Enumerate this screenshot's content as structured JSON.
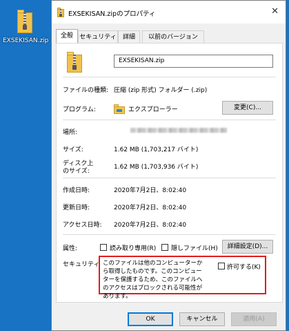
{
  "desktop": {
    "icon_label": "EXSEKISAN.zip"
  },
  "window": {
    "title": "EXSEKISAN.zipのプロパティ",
    "close_glyph": "✕"
  },
  "tabs": [
    {
      "label": "全般",
      "active": true
    },
    {
      "label": "セキュリティ"
    },
    {
      "label": "詳細"
    },
    {
      "label": "以前のバージョン"
    }
  ],
  "general": {
    "file_name": "EXSEKISAN.zip",
    "type_label": "ファイルの種類:",
    "type_value": "圧縮 (zip 形式) フォルダー (.zip)",
    "program_label": "プログラム:",
    "program_value": "エクスプローラー",
    "change_button": "変更(C)...",
    "location_label": "場所:",
    "size_label": "サイズ:",
    "size_value": "1.62 MB (1,703,217 バイト)",
    "disk_size_label_1": "ディスク上",
    "disk_size_label_2": "のサイズ:",
    "disk_size_value": "1.62 MB (1,703,936 バイト)",
    "created_label": "作成日時:",
    "created_value": "2020年7月2日、8:02:40",
    "modified_label": "更新日時:",
    "modified_value": "2020年7月2日、8:02:40",
    "accessed_label": "アクセス日時:",
    "accessed_value": "2020年7月2日、8:02:40",
    "attributes_label": "属性:",
    "readonly_label": "読み取り専用(R)",
    "hidden_label": "隠しファイル(H)",
    "advanced_button": "詳細設定(D)...",
    "security_label": "セキュリティ:",
    "security_warning": "このファイルは他のコンピューターから取得したものです。このコンピューターを保護するため、このファイルへのアクセスはブロックされる可能性があります。",
    "allow_label": "許可する(K)"
  },
  "footer": {
    "ok": "OK",
    "cancel": "キャンセル",
    "apply": "適用(A)"
  },
  "colors": {
    "desktop": "#1873c5",
    "warning_border": "#e21b1b",
    "primary_border": "#0078d7"
  }
}
